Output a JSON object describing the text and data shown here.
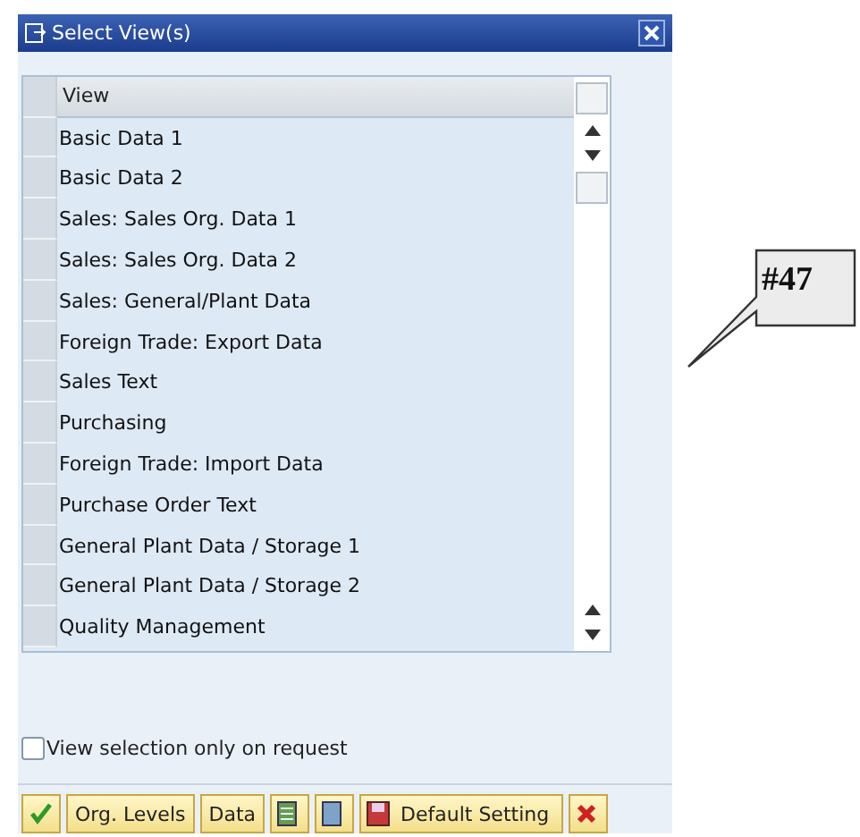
{
  "window": {
    "title": "Select View(s)"
  },
  "table": {
    "columns": [
      "View"
    ],
    "rows": [
      {
        "view": "Basic Data 1"
      },
      {
        "view": "Basic Data 2"
      },
      {
        "view": "Sales: Sales Org. Data 1"
      },
      {
        "view": "Sales: Sales Org. Data 2"
      },
      {
        "view": "Sales: General/Plant Data"
      },
      {
        "view": "Foreign Trade: Export Data"
      },
      {
        "view": "Sales Text"
      },
      {
        "view": "Purchasing"
      },
      {
        "view": "Foreign Trade: Import Data"
      },
      {
        "view": "Purchase Order Text"
      },
      {
        "view": "General Plant Data / Storage 1"
      },
      {
        "view": "General Plant Data / Storage 2"
      },
      {
        "view": "Quality Management"
      }
    ]
  },
  "option": {
    "label": "View selection only on request",
    "checked": false
  },
  "buttons": [
    {
      "kind": "check"
    },
    {
      "kind": "text",
      "label": "Org. Levels"
    },
    {
      "kind": "text",
      "label": "Data"
    },
    {
      "kind": "select-all"
    },
    {
      "kind": "deselect-all"
    },
    {
      "kind": "save",
      "label": "Default Setting"
    },
    {
      "kind": "cancel"
    }
  ],
  "callout": {
    "label": "#47"
  }
}
